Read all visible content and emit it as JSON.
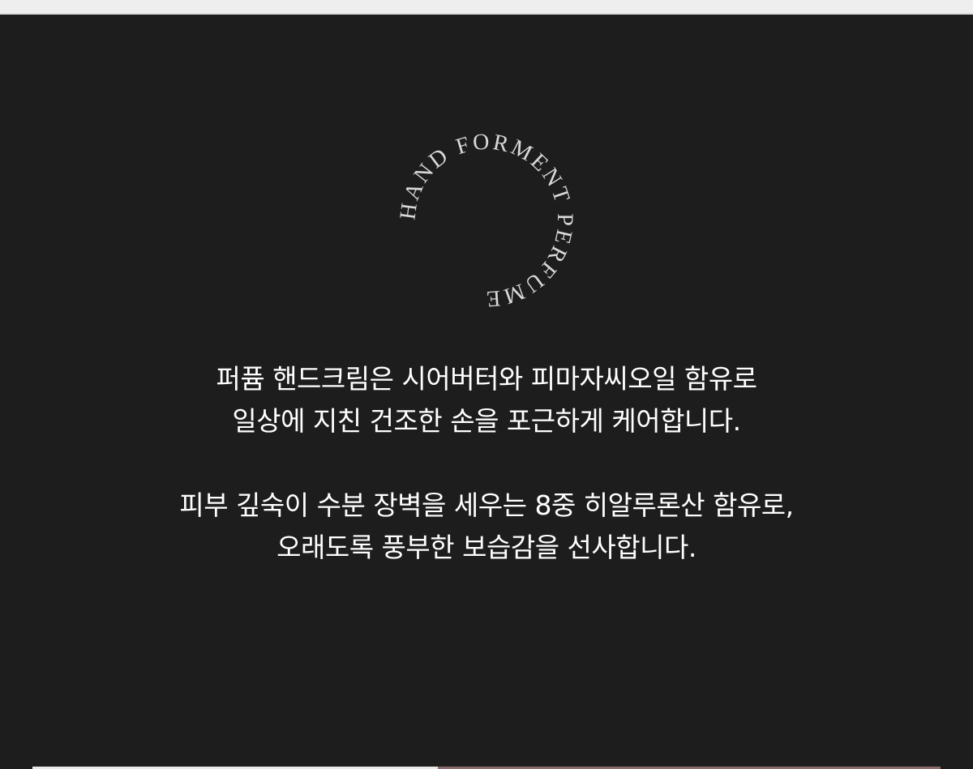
{
  "seal": {
    "ring_text": "HAND FORMENT PERFUME"
  },
  "description": {
    "paragraph_1": {
      "line_1": "퍼퓸 핸드크림은 시어버터와 피마자씨오일 함유로",
      "line_2": "일상에 지친 건조한 손을 포근하게 케어합니다."
    },
    "paragraph_2": {
      "line_1": "피부 깊숙이 수분 장벽을 세우는 8중 히알루론산 함유로,",
      "line_2": "오래도록 풍부한 보습감을 선사합니다."
    }
  },
  "colors": {
    "background": "#1d1d1d",
    "text": "#ffffff",
    "seal_text": "#d9d9d9"
  }
}
